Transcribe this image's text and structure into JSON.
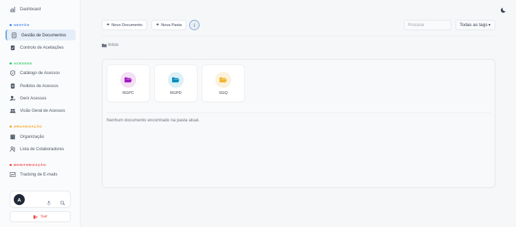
{
  "sidebar": {
    "items": [
      {
        "label": "Dashboard",
        "icon": "chart-bar-icon"
      },
      {
        "label": "Gestão de Documentos",
        "icon": "document-icon",
        "active": true
      },
      {
        "label": "Controlo de Aceitações",
        "icon": "clipboard-check-icon"
      },
      {
        "label": "Catálogo de Acessos",
        "icon": "shield-check-icon"
      },
      {
        "label": "Pedidos de Acessos",
        "icon": "list-icon"
      },
      {
        "label": "Gerir Acessos",
        "icon": "user-edit-icon"
      },
      {
        "label": "Visão Geral de Acessos",
        "icon": "users-icon"
      },
      {
        "label": "Organização",
        "icon": "building-icon"
      },
      {
        "label": "Lista de Colaboradores",
        "icon": "people-icon"
      },
      {
        "label": "Tracking de E-mails",
        "icon": "email-tracking-icon"
      }
    ],
    "sections": [
      {
        "label": "GESTÃO",
        "color": "#3b82f6"
      },
      {
        "label": "ACESSOS",
        "color": "#22c55e"
      },
      {
        "label": "ORGANIZAÇÃO",
        "color": "#f59e0b"
      },
      {
        "label": "MONITORIZAÇÃO",
        "color": "#ef4444"
      }
    ],
    "user": {
      "initial": "A"
    },
    "logout_label": "Sair"
  },
  "toolbar": {
    "new_document_label": "Novo Documento",
    "new_folder_label": "Nova Pasta",
    "info_label": "i",
    "search_placeholder": "Procurar",
    "tags_selected": "Todas as tags"
  },
  "breadcrumb": {
    "label": "Início"
  },
  "folders": [
    {
      "name": "RGPC",
      "bg": "#f3e0f5",
      "color": "#a01ac0"
    },
    {
      "name": "RGPD",
      "bg": "#ddf0f7",
      "color": "#0a8cc0"
    },
    {
      "name": "SGQ",
      "bg": "#fbf1dc",
      "color": "#f0b52c"
    }
  ],
  "empty_message": "Nenhum documento encontrado na pasta atual.",
  "colors": {
    "accent": "#6aa5d8",
    "active_bg": "#e5eef8",
    "logout": "#ef4444"
  }
}
